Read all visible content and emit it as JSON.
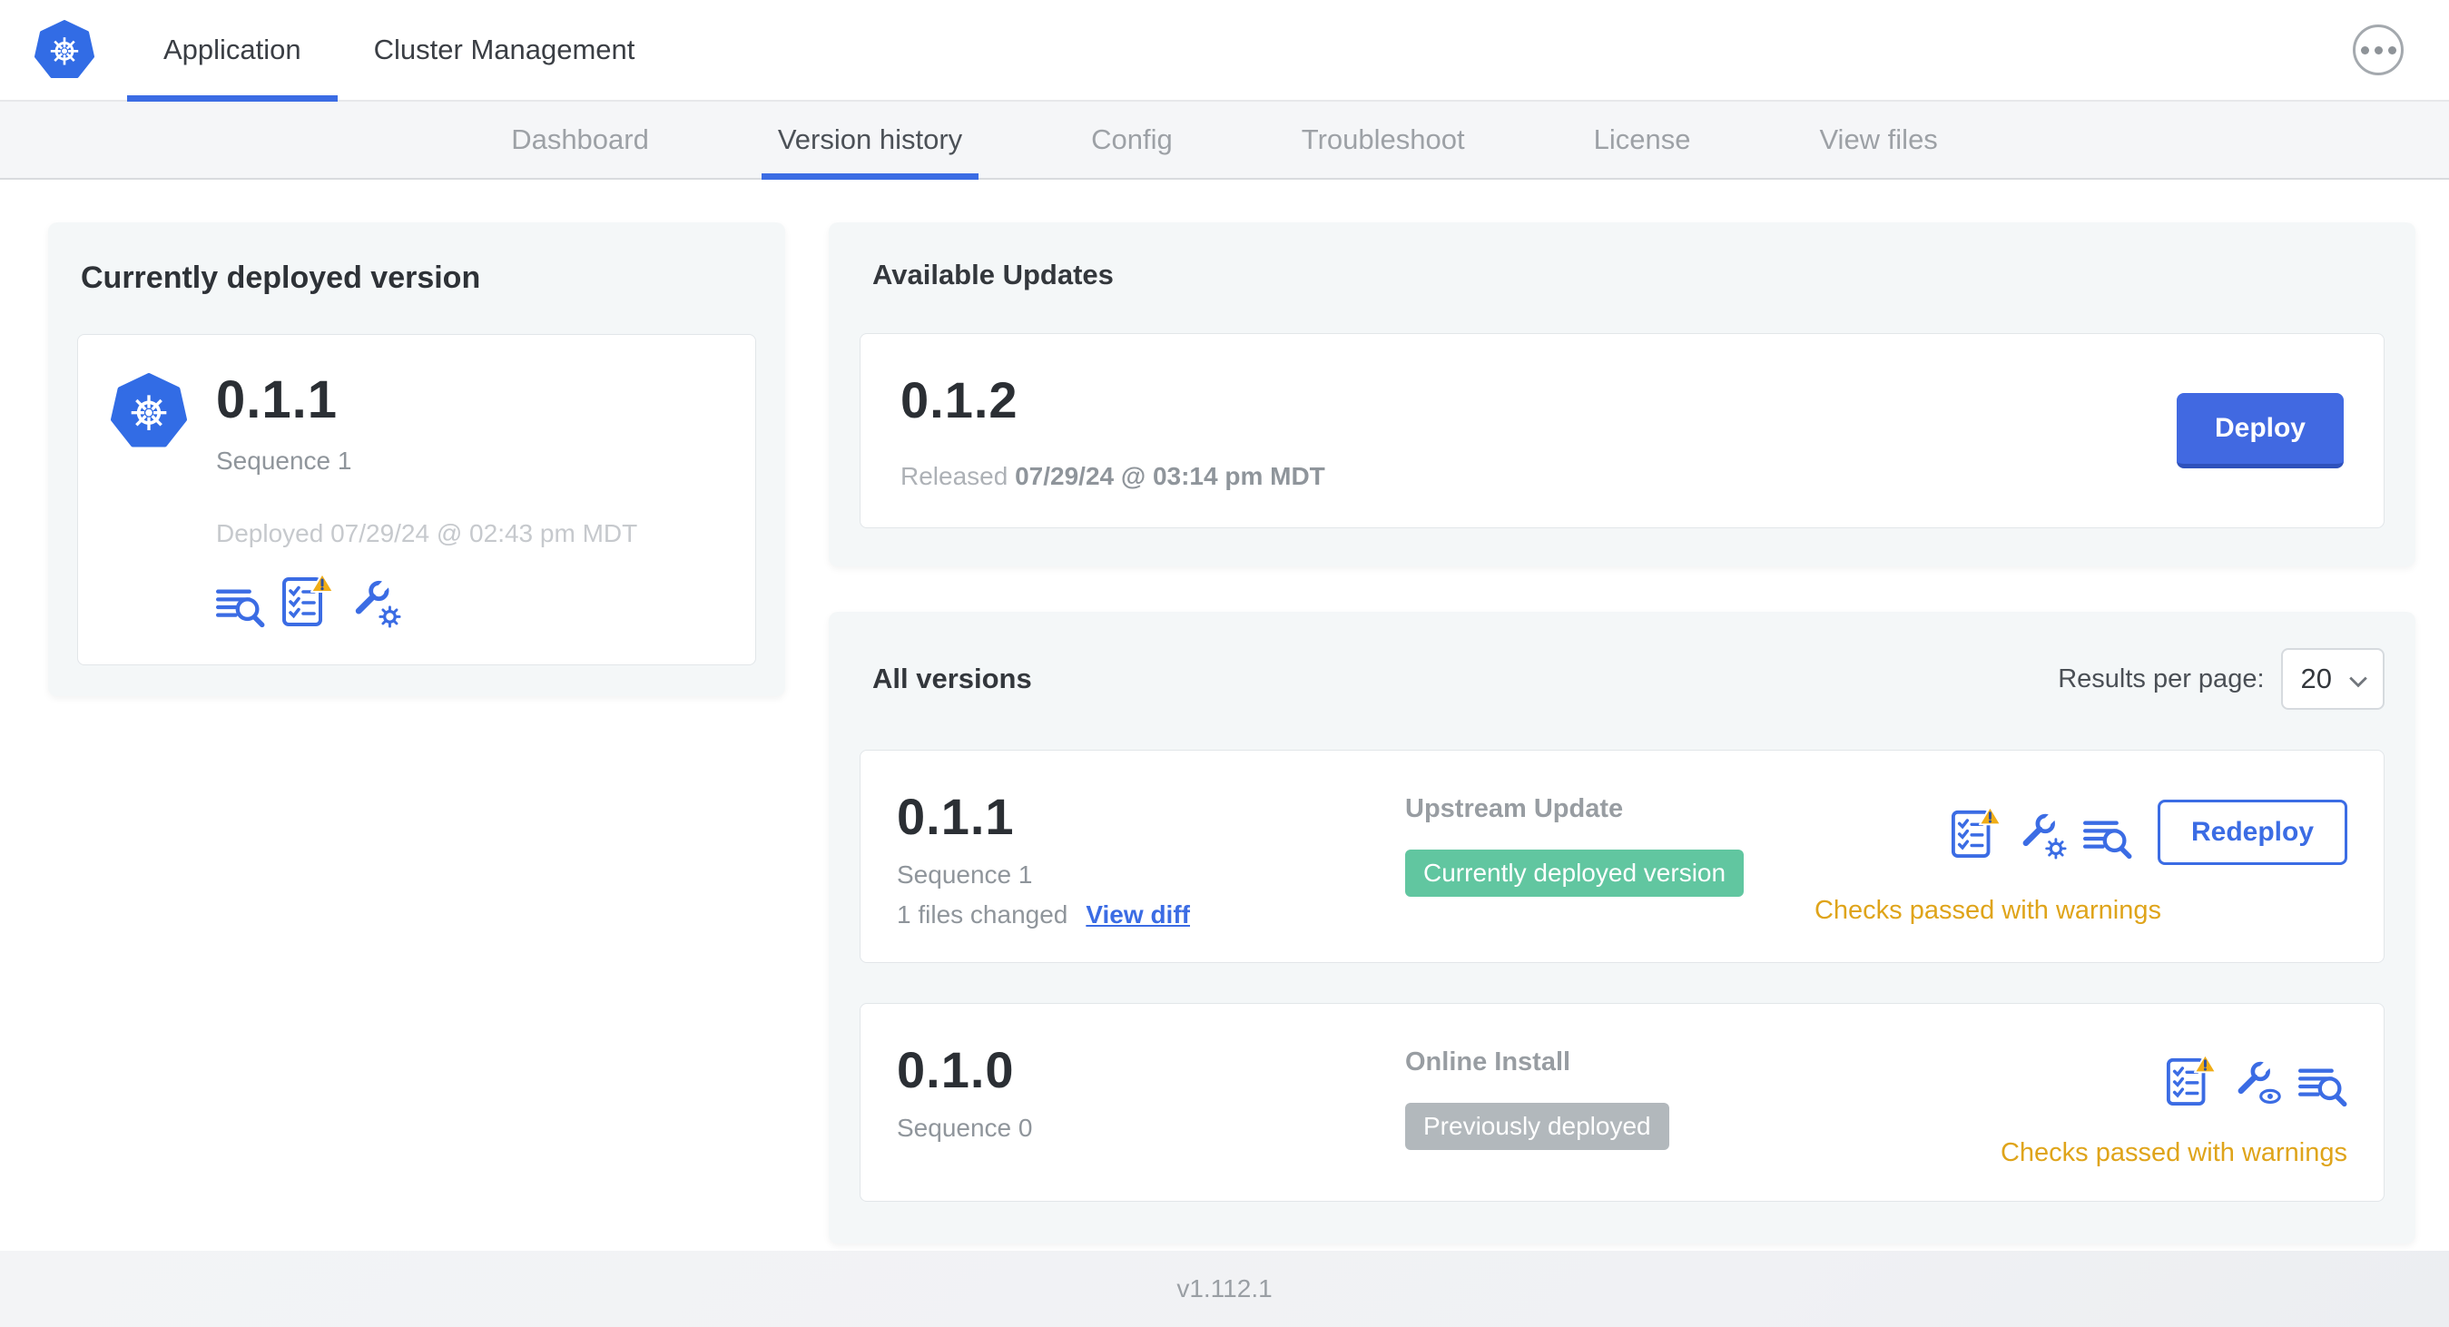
{
  "header": {
    "logo": "kubernetes-logo",
    "tabs": [
      {
        "label": "Application",
        "active": true
      },
      {
        "label": "Cluster Management",
        "active": false
      }
    ],
    "menu_icon": "ellipsis-icon"
  },
  "subnav": {
    "items": [
      {
        "label": "Dashboard",
        "active": false
      },
      {
        "label": "Version history",
        "active": true
      },
      {
        "label": "Config",
        "active": false
      },
      {
        "label": "Troubleshoot",
        "active": false
      },
      {
        "label": "License",
        "active": false
      },
      {
        "label": "View files",
        "active": false
      }
    ]
  },
  "currently_deployed": {
    "title": "Currently deployed version",
    "version": "0.1.1",
    "sequence": "Sequence 1",
    "deployed": "Deployed 07/29/24 @ 02:43 pm MDT",
    "icons": [
      "release-notes-icon",
      "preflight-checks-warning-icon",
      "edit-config-icon"
    ]
  },
  "available_updates": {
    "title": "Available Updates",
    "version": "0.1.2",
    "released_prefix": "Released",
    "released_date": "07/29/24 @ 03:14 pm MDT",
    "deploy_label": "Deploy"
  },
  "all_versions": {
    "title": "All versions",
    "results_per_page_label": "Results per page:",
    "results_per_page_value": "20",
    "rows": [
      {
        "version": "0.1.1",
        "sequence": "Sequence 1",
        "files_changed": "1 files changed",
        "view_diff_label": "View diff",
        "source": "Upstream Update",
        "badge": "Currently deployed version",
        "badge_color": "green",
        "icons": [
          "preflight-checks-warning-icon",
          "edit-config-icon",
          "release-notes-icon"
        ],
        "action_label": "Redeploy",
        "status": "Checks passed with warnings"
      },
      {
        "version": "0.1.0",
        "sequence": "Sequence 0",
        "source": "Online Install",
        "badge": "Previously deployed",
        "badge_color": "gray",
        "icons": [
          "preflight-checks-warning-icon",
          "view-config-icon",
          "release-notes-icon"
        ],
        "status": "Checks passed with warnings"
      }
    ]
  },
  "footer": {
    "app_version": "v1.112.1"
  },
  "colors": {
    "kubernetes_blue": "#326ce5",
    "accent_blue": "#3b6ce4",
    "deploy_button_blue": "#4169e1",
    "success_green": "#61c6a0",
    "muted_badge_gray": "#b2b8bc",
    "warning_amber": "#dfa41a"
  }
}
